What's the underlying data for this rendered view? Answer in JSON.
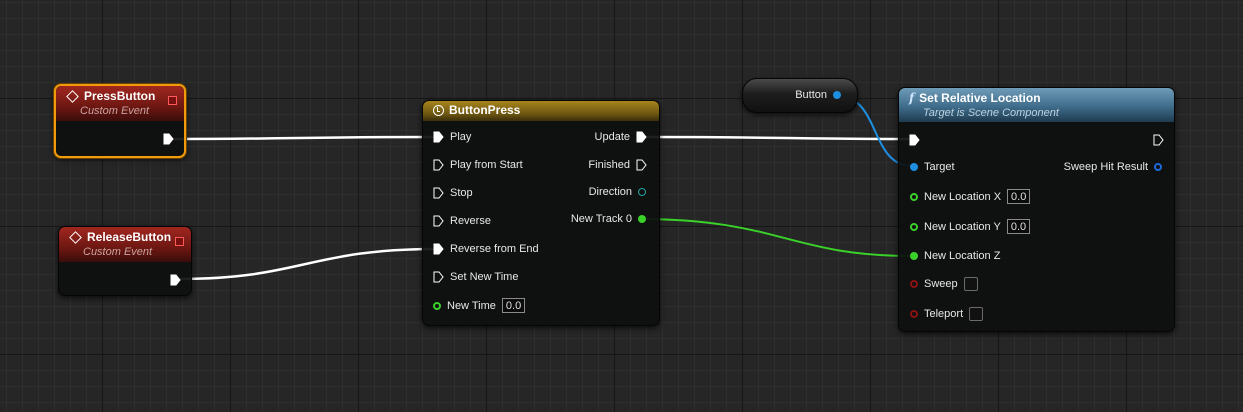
{
  "nodes": {
    "press_button": {
      "title": "PressButton",
      "subtitle": "Custom Event"
    },
    "release_button": {
      "title": "ReleaseButton",
      "subtitle": "Custom Event"
    },
    "timeline": {
      "title": "ButtonPress",
      "inputs": [
        "Play",
        "Play from Start",
        "Stop",
        "Reverse",
        "Reverse from End",
        "Set New Time"
      ],
      "new_time_label": "New Time",
      "new_time_value": "0.0",
      "outputs": [
        "Update",
        "Finished",
        "Direction",
        "New Track 0"
      ]
    },
    "button_var": {
      "label": "Button"
    },
    "set_relative_location": {
      "title": "Set Relative Location",
      "subtitle": "Target is Scene Component",
      "target_label": "Target",
      "sweep_hit_label": "Sweep Hit Result",
      "x_label": "New Location X",
      "x_value": "0.0",
      "y_label": "New Location Y",
      "y_value": "0.0",
      "z_label": "New Location Z",
      "sweep_label": "Sweep",
      "teleport_label": "Teleport"
    }
  },
  "colors": {
    "exec_wire": "#ffffff",
    "float_wire": "#3ad12a",
    "object_wire": "#1e8fe0",
    "selection": "#f09b0c"
  },
  "icons": {
    "event": "event-diamond-icon",
    "timeline": "clock-icon",
    "function": "function-icon"
  }
}
